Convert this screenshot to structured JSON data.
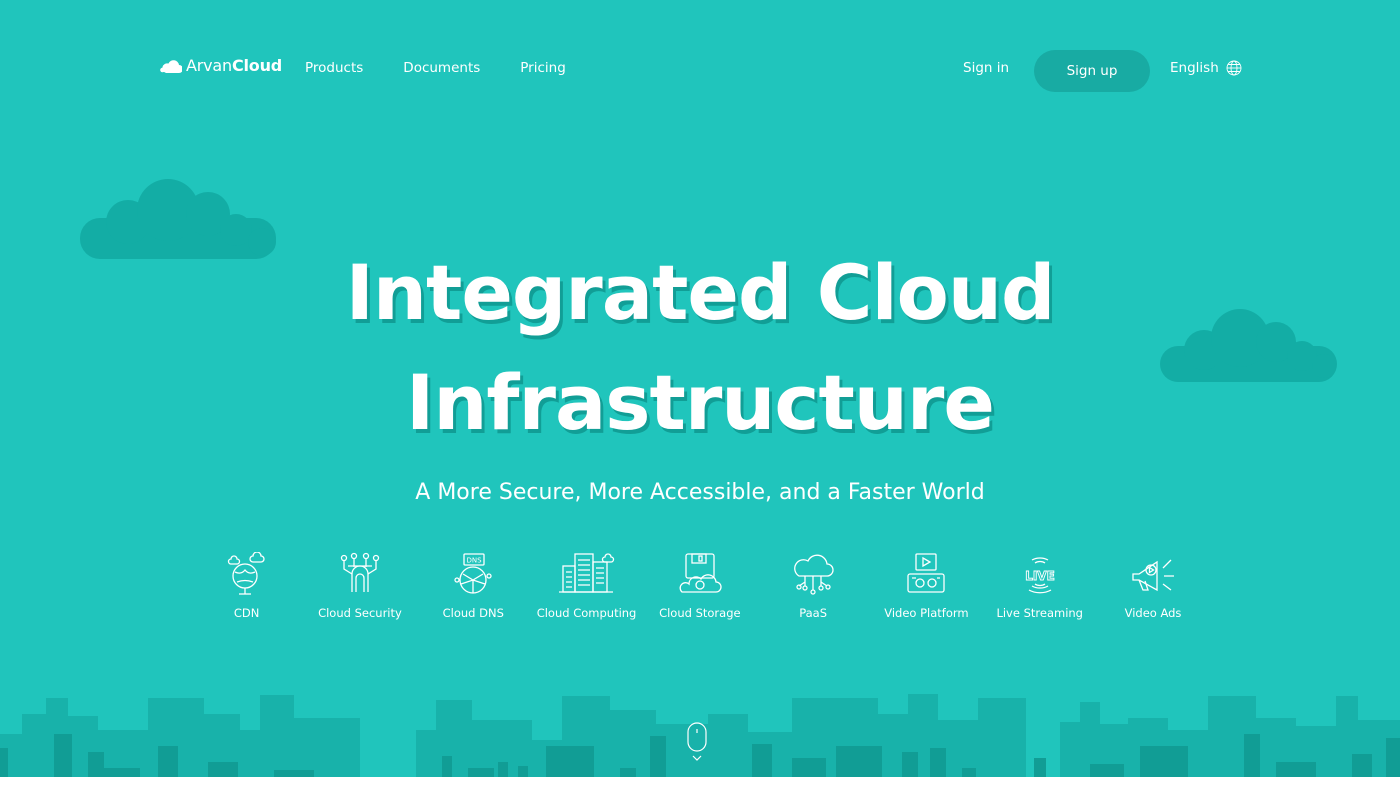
{
  "header": {
    "logo": {
      "light": "Arvan",
      "bold": "Cloud"
    },
    "nav": [
      "Products",
      "Documents",
      "Pricing"
    ],
    "sign_in": "Sign in",
    "sign_up": "Sign up",
    "language": "English"
  },
  "hero": {
    "title_line1": "Integrated Cloud",
    "title_line2": "Infrastructure",
    "subtitle": "A More Secure, More Accessible, and a Faster World"
  },
  "products": [
    {
      "label": "CDN",
      "icon": "globe-cloud-icon"
    },
    {
      "label": "Cloud Security",
      "icon": "shield-network-icon"
    },
    {
      "label": "Cloud DNS",
      "icon": "dns-globe-icon"
    },
    {
      "label": "Cloud Computing",
      "icon": "server-rack-icon"
    },
    {
      "label": "Cloud Storage",
      "icon": "storage-drive-icon"
    },
    {
      "label": "PaaS",
      "icon": "cloud-network-icon"
    },
    {
      "label": "Video Platform",
      "icon": "video-player-icon"
    },
    {
      "label": "Live Streaming",
      "icon": "live-broadcast-icon"
    },
    {
      "label": "Video Ads",
      "icon": "megaphone-icon"
    }
  ],
  "colors": {
    "background": "#20c5bc",
    "button": "#18aba3",
    "cloud": "#13ada5",
    "city_light": "#18b2aa",
    "city_dark": "#119d95"
  }
}
